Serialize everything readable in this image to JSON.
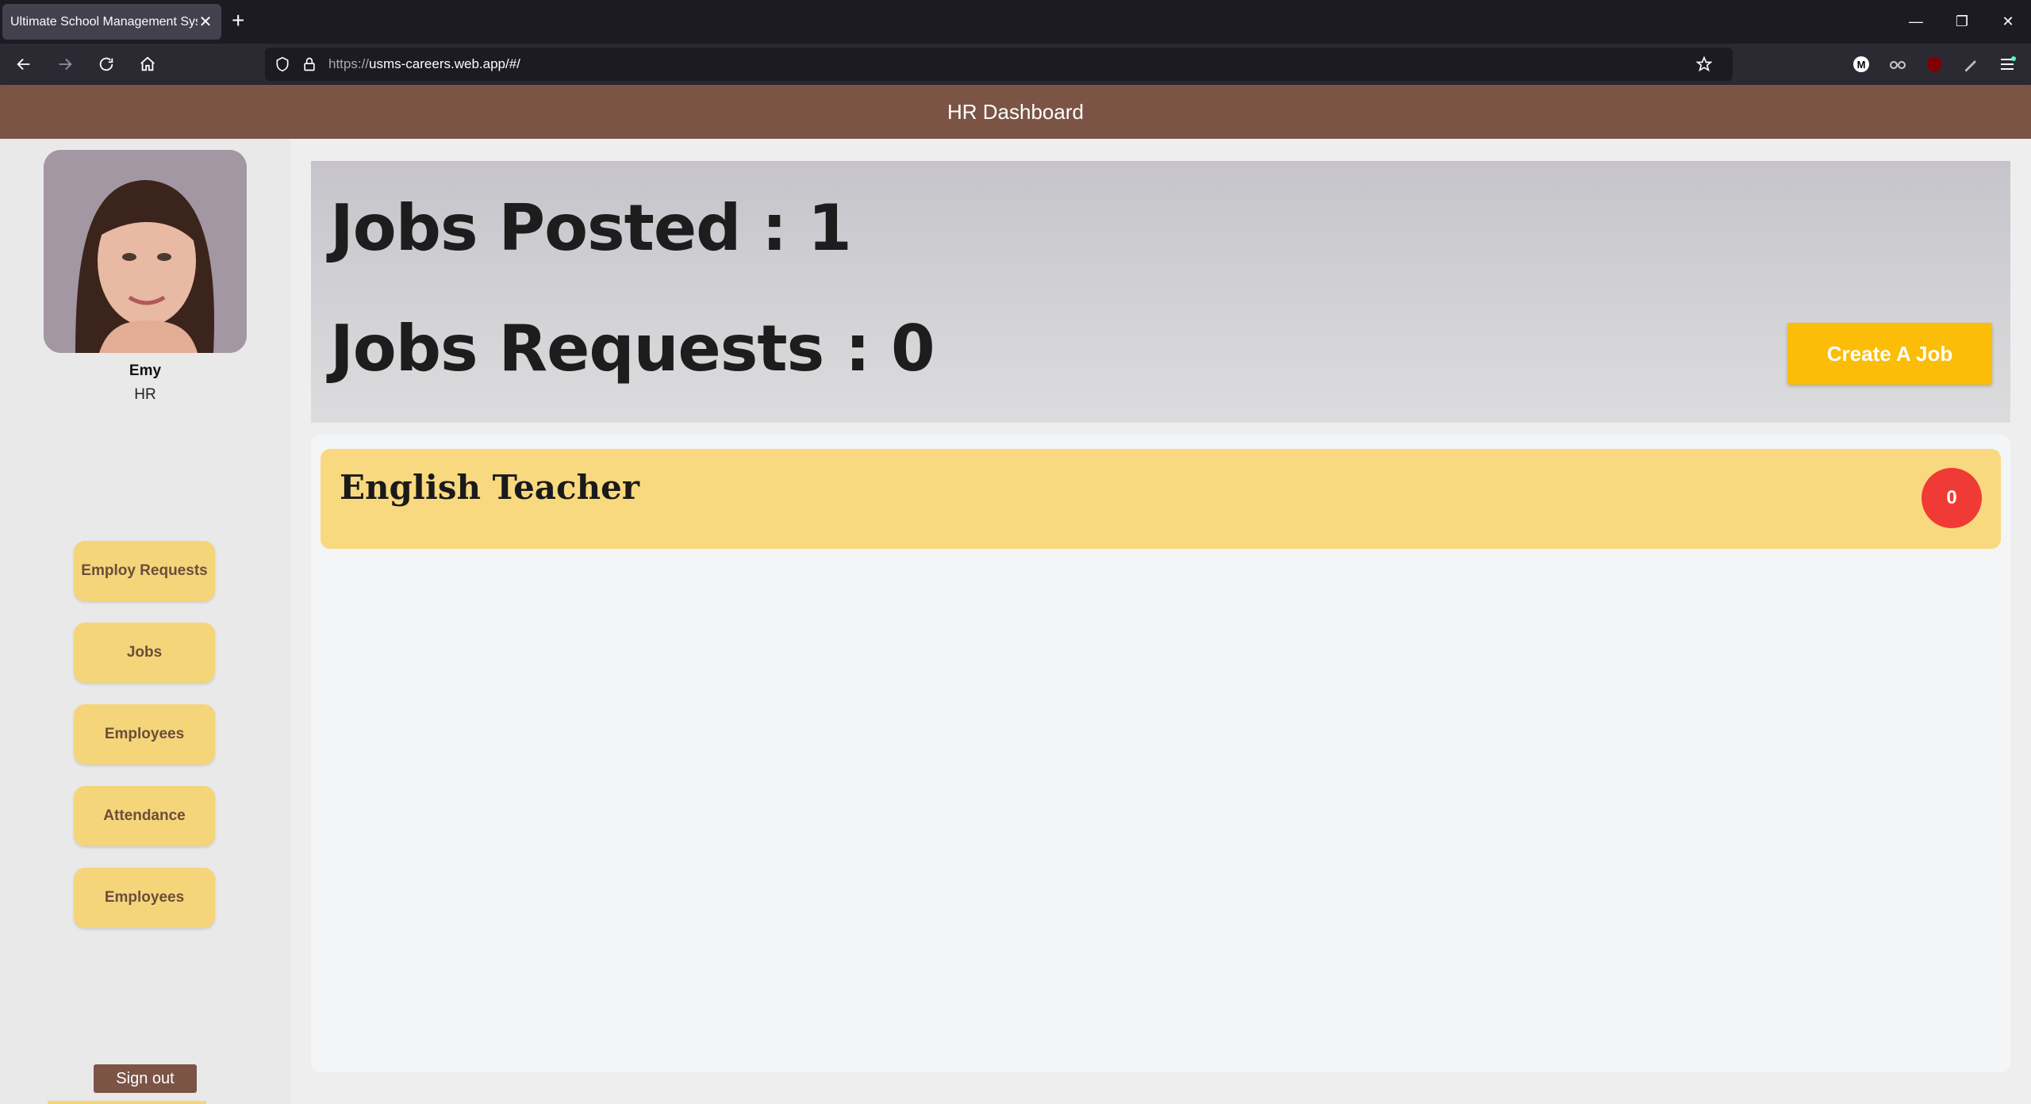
{
  "browser": {
    "tab_title": "Ultimate School Management System",
    "tab_close": "✕",
    "new_tab": "+",
    "url_proto": "https://",
    "url_rest": "usms-careers.web.app/#/",
    "window_controls": {
      "minimize": "—",
      "restore": "❐",
      "close": "✕"
    }
  },
  "header": {
    "title": "HR Dashboard"
  },
  "sidebar": {
    "user_name": "Emy",
    "user_role": "HR",
    "items": [
      {
        "label": "Employ Requests"
      },
      {
        "label": "Jobs"
      },
      {
        "label": "Employees"
      },
      {
        "label": "Attendance"
      },
      {
        "label": "Employees"
      }
    ],
    "signout_label": "Sign out"
  },
  "stats": {
    "jobs_posted": "Jobs Posted : 1",
    "jobs_requests": "Jobs Requests : 0",
    "create_label": "Create A Job"
  },
  "jobs": [
    {
      "title": "English Teacher",
      "count": "0"
    }
  ],
  "colors": {
    "header": "#7b5446",
    "sidebar_button": "#f5d57a",
    "create_button": "#fbbd08",
    "job_card": "#f9d97f",
    "count_badge": "#f03a35"
  }
}
